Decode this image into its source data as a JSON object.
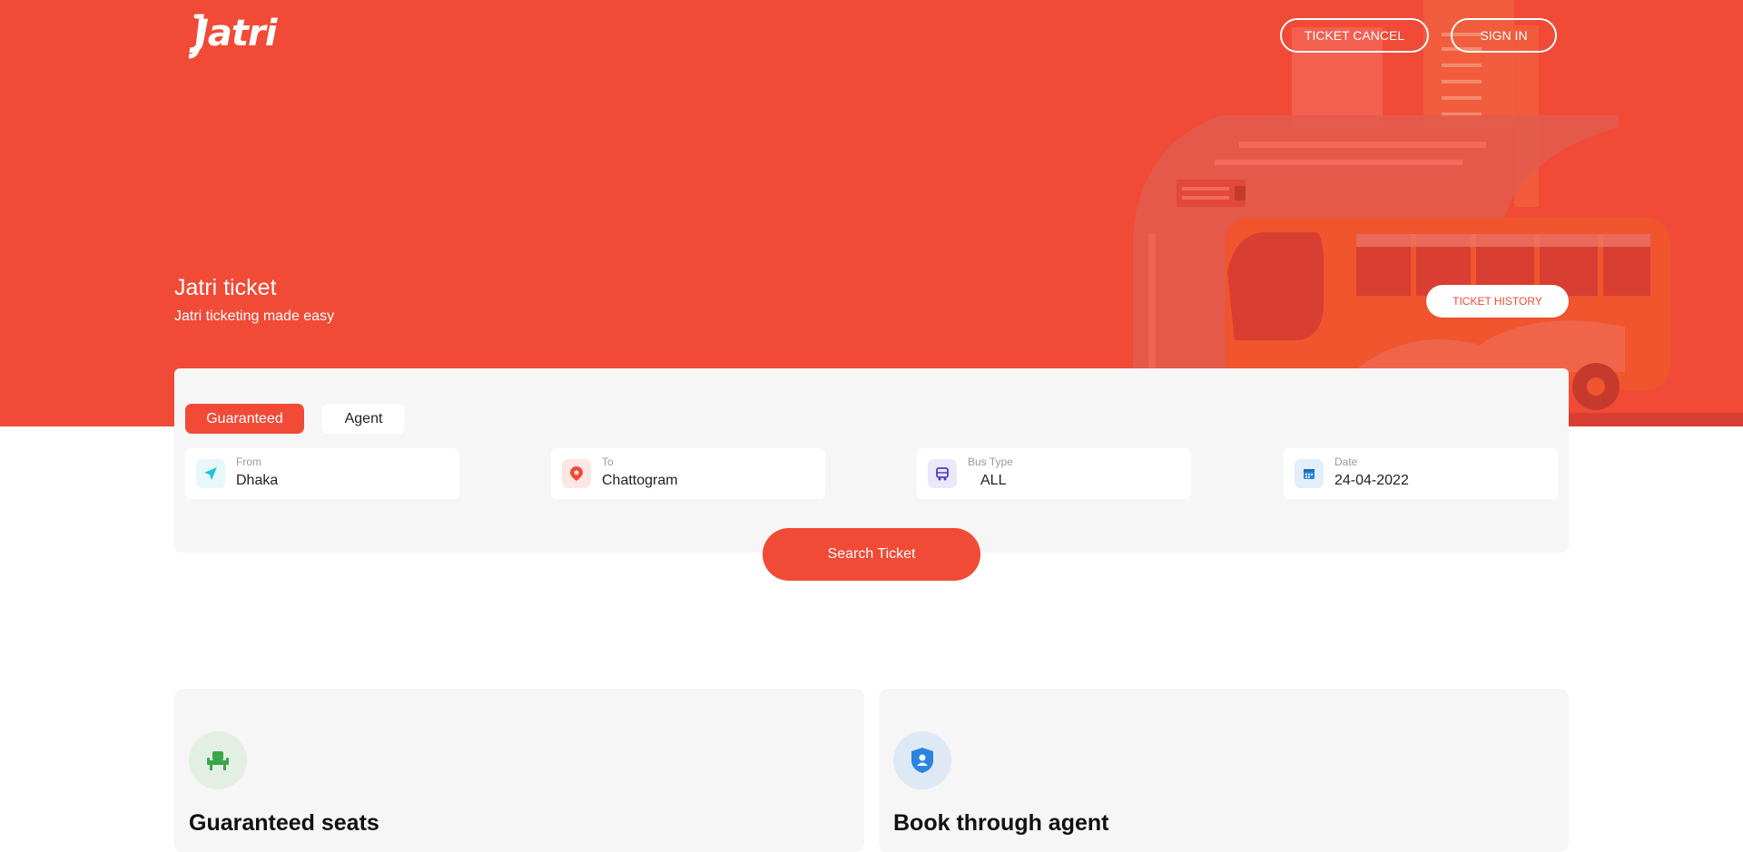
{
  "header": {
    "logo_text": "Jatri",
    "ticket_cancel_label": "TICKET CANCEL",
    "sign_in_label": "SIGN IN",
    "ticket_history_label": "TICKET HISTORY"
  },
  "hero": {
    "title": "Jatri ticket",
    "subtitle": "Jatri ticketing made easy"
  },
  "search": {
    "tabs": [
      {
        "label": "Guaranteed",
        "active": true
      },
      {
        "label": "Agent",
        "active": false
      }
    ],
    "fields": [
      {
        "label": "From",
        "value": "Dhaka",
        "icon": "navigation-arrow-icon"
      },
      {
        "label": "To",
        "value": "Chattogram",
        "icon": "map-pin-icon"
      },
      {
        "label": "Bus Type",
        "value": "ALL",
        "icon": "bus-icon"
      },
      {
        "label": "Date",
        "value": "24-04-2022",
        "icon": "calendar-icon"
      }
    ],
    "search_button_label": "Search Ticket"
  },
  "features": [
    {
      "title": "Guaranteed seats",
      "icon": "seat-icon"
    },
    {
      "title": "Book through agent",
      "icon": "shield-user-icon"
    }
  ],
  "colors": {
    "brand": "#f14a36",
    "panel_bg": "#f6f6f6"
  }
}
